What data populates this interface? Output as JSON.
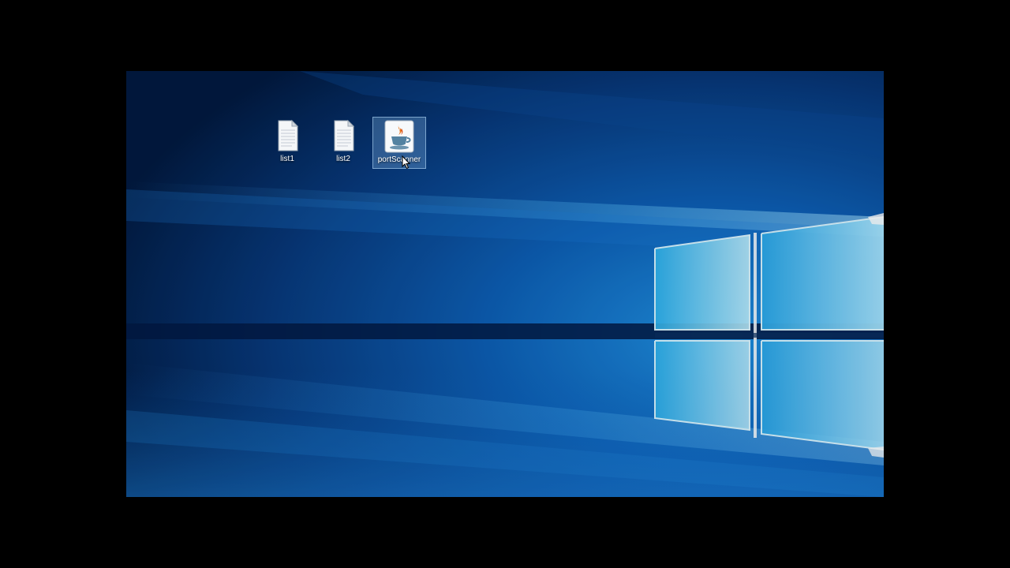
{
  "desktop": {
    "wallpaper": "windows-10-hero-light-window",
    "colors": {
      "frame": "#000000",
      "background_deep": "#02163a",
      "background_mid": "#0a4fa0",
      "glow": "#7fdcff",
      "selection": "#96c8f5"
    },
    "icons": [
      {
        "label": "list1",
        "icon": "text-file-icon",
        "selected": false
      },
      {
        "label": "list2",
        "icon": "text-file-icon",
        "selected": false
      },
      {
        "label": "portScanner",
        "icon": "java-jar-icon",
        "selected": true
      }
    ]
  }
}
